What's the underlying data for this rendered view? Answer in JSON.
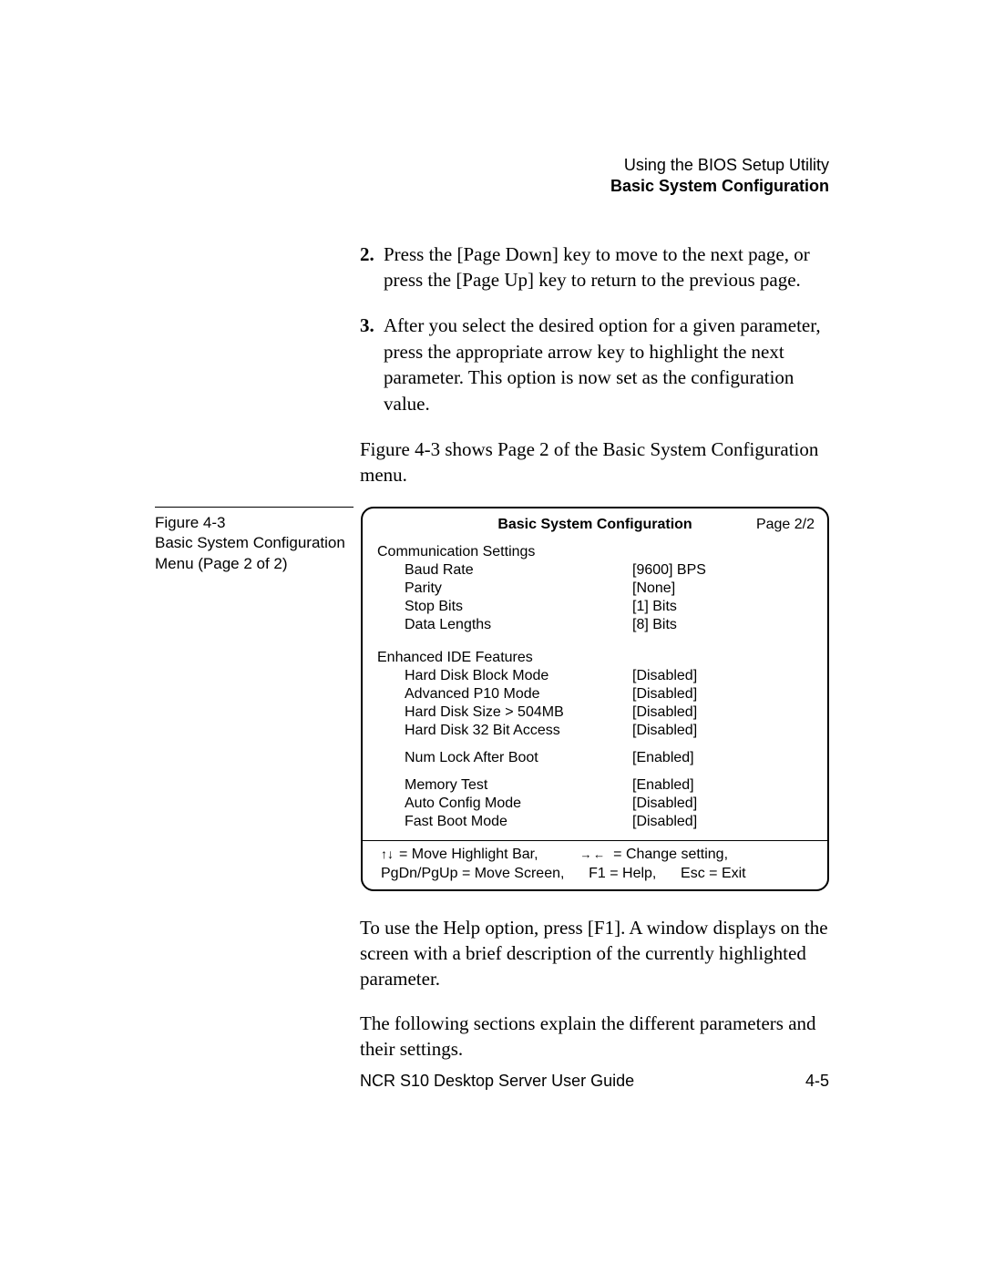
{
  "header": {
    "line1": "Using the BIOS Setup Utility",
    "line2": "Basic System Configuration"
  },
  "steps": {
    "s2num": "2.",
    "s2": "Press the [Page Down] key to move to the next page, or press the [Page Up] key to return to the previous page.",
    "s3num": "3.",
    "s3": "After you select the desired option for a given parameter, press the appropriate arrow key to highlight the next parameter. This option is now set as the configuration value."
  },
  "intro": "Figure 4-3 shows Page 2 of the Basic System Configuration menu.",
  "figcap": {
    "l1": "Figure 4-3",
    "l2": "Basic System Configuration Menu (Page 2 of 2)"
  },
  "bios": {
    "title": "Basic System Configuration",
    "page": "Page 2/2",
    "sect1": "Communication Settings",
    "r1l": "Baud Rate",
    "r1v": "[9600] BPS",
    "r2l": "Parity",
    "r2v": "[None]",
    "r3l": "Stop Bits",
    "r3v": "[1] Bits",
    "r4l": "Data Lengths",
    "r4v": "[8] Bits",
    "sect2": "Enhanced IDE Features",
    "r5l": "Hard Disk Block Mode",
    "r5v": "[Disabled]",
    "r6l": "Advanced P10 Mode",
    "r6v": "[Disabled]",
    "r7l": "Hard Disk Size > 504MB",
    "r7v": "[Disabled]",
    "r8l": "Hard Disk 32 Bit Access",
    "r8v": "[Disabled]",
    "r9l": "Num Lock After Boot",
    "r9v": "[Enabled]",
    "r10l": "Memory Test",
    "r10v": "[Enabled]",
    "r11l": "Auto Config Mode",
    "r11v": "[Disabled]",
    "r12l": "Fast Boot Mode",
    "r12v": "[Disabled]",
    "leg_ud": "= Move Highlight Bar,",
    "leg_lr": "= Change setting,",
    "leg2a": "PgDn/PgUp = Move Screen,",
    "leg2b": "F1 = Help,",
    "leg2c": "Esc = Exit"
  },
  "after1": "To use the Help option, press [F1]. A window displays on the screen with a brief description of the currently highlighted parameter.",
  "after2": "The following sections explain the different parameters and their settings.",
  "footer": {
    "title": "NCR S10 Desktop Server User Guide",
    "pageno": "4-5"
  }
}
